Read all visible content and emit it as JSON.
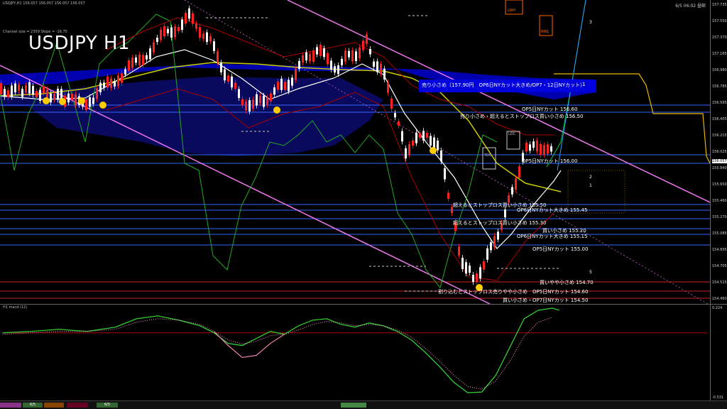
{
  "header": {
    "symbol_info": "USDJPY,H1  156.057 156.057 156.057 156.057",
    "big_title": "USDJPY H1",
    "channel_info": "Channel size = 2359  Slope = -16.75",
    "corner_time": "6/5 06:02 昼邮"
  },
  "colors": {
    "background": "#000000",
    "candle_up": "#ffffff",
    "candle_down": "#ff0000",
    "cloud_blue": "#0000cc",
    "channel_line": "#ff66ff",
    "macd_line": "#33cc33",
    "signal_line": "#ff99cc"
  },
  "price_axis": {
    "ticks": [
      "157.735",
      "157.550",
      "157.370",
      "157.165",
      "156.980",
      "156.785",
      "156.595",
      "156.405",
      "156.215",
      "156.025",
      "155.840",
      "155.650",
      "155.460",
      "155.270",
      "155.085",
      "154.895",
      "154.705",
      "154.515",
      "154.460"
    ],
    "current": "156.057"
  },
  "level_labels": [
    "売り小さめ（157.90円　OP6日NYカット大きめ/OP7・12日NYカット）",
    "OP5日NYカット 156.60",
    "売り小さめ・超えるとストップロス買い小さめ 156.50",
    "OP5日NYカット 156.00",
    "超えるとストップロス買い小さめ 155.50",
    "OP6日NYカット大きめ 155.45",
    "超えるとストップロス買い小さめ 155.30",
    "買い小さめ 155.20",
    "OP6日NYカット大きめ 155.15",
    "OP5日NYカット 155.00",
    "買いやや小さめ 154.70",
    "割り込むとストップロス売りやや小さめ",
    "OP5日NYカット 154.60",
    "買い小さめ・OP7日NYカット 154.50"
  ],
  "wave_numbers": [
    "3",
    "2",
    "1",
    "5"
  ],
  "markers": {
    "ldc": "LDC",
    "ydc": "YDC",
    "lwh": "LWH",
    "nwl": "NWL"
  },
  "macd": {
    "title": "H1  macd (12)",
    "top_tick": "0.224",
    "bottom_tick": "-0.531"
  },
  "bottom_tabs": [
    "6/5",
    "6/5"
  ]
}
